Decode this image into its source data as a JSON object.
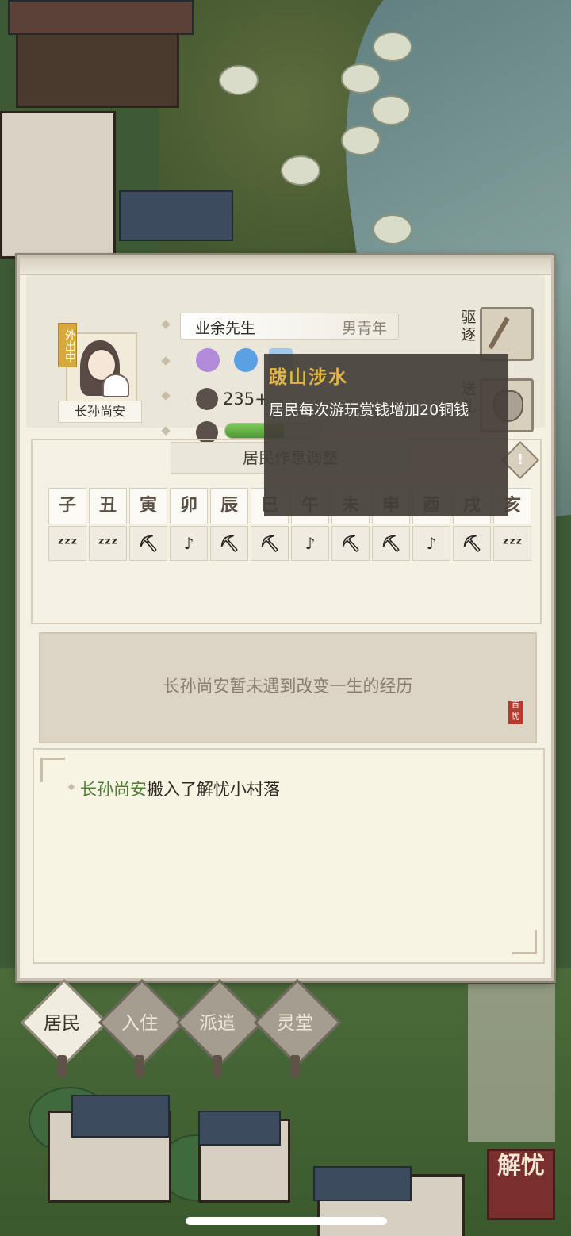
{
  "resident": {
    "status_badge": "外出中",
    "name": "长孙尚安",
    "occupation": "业余先生",
    "category": "男青年",
    "money": "235+",
    "hp_fraction": 0.62
  },
  "actions": {
    "expel_label": "驱逐",
    "gift_label": "送礼"
  },
  "tooltip": {
    "title": "跋山涉水",
    "description": "居民每次游玩赏钱增加20铜钱"
  },
  "schedule": {
    "title": "居民作息调整",
    "warning_glyph": "!",
    "hours": [
      "子",
      "丑",
      "寅",
      "卯",
      "辰",
      "巳",
      "午",
      "未",
      "申",
      "酉",
      "戌",
      "亥"
    ],
    "activities": [
      "sleep",
      "sleep",
      "work",
      "play",
      "work",
      "work",
      "play",
      "work",
      "work",
      "play",
      "work",
      "sleep"
    ],
    "activity_glyphs": {
      "sleep": "ᶻᶻᶻ",
      "work": "⛏",
      "play": "♪"
    }
  },
  "story": {
    "text": "长孙尚安暂未遇到改变一生的经历"
  },
  "log": {
    "name": "长孙尚安",
    "rest": "搬入了解忧小村落"
  },
  "tabs": [
    {
      "label": "居民",
      "active": true
    },
    {
      "label": "入住",
      "active": false
    },
    {
      "label": "派遣",
      "active": false
    },
    {
      "label": "灵堂",
      "active": false
    }
  ],
  "corner_button": {
    "label": "解忧"
  }
}
